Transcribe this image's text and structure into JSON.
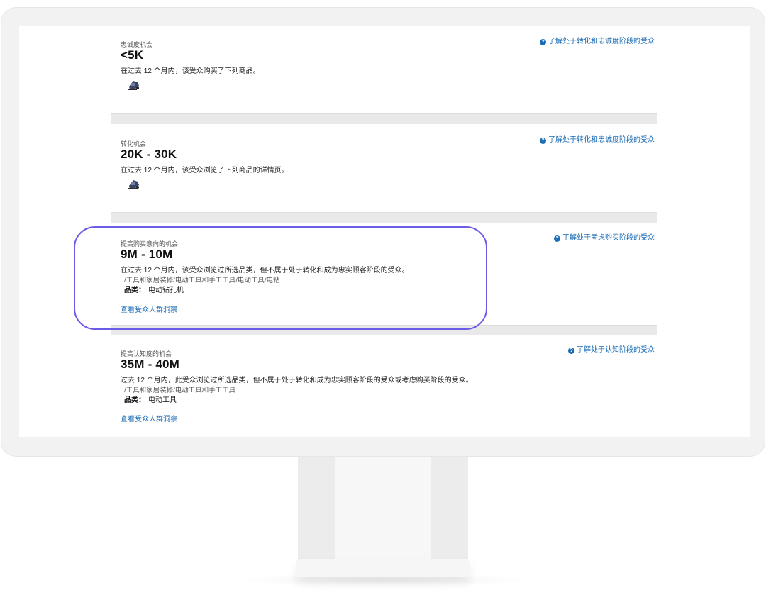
{
  "sections": [
    {
      "kicker": "忠诚度机会",
      "range": "<5K",
      "description": "在过去 12 个月内，该受众购买了下列商品。",
      "help_link": "了解处于转化和忠诚度阶段的受众",
      "thumb_icon": "power-tool-product-icon"
    },
    {
      "kicker": "转化机会",
      "range": "20K - 30K",
      "description": "在过去 12 个月内，该受众浏览了下列商品的详情页。",
      "help_link": "了解处于转化和忠诚度阶段的受众",
      "thumb_icon": "power-tool-product-icon"
    },
    {
      "kicker": "提高购买意向的机会",
      "range": "9M - 10M",
      "description": "在过去 12 个月内，该受众浏览过所选品类，但不属于处于转化和成为忠实顾客阶段的受众。",
      "help_link": "了解处于考虑购买阶段的受众",
      "category_path": "/工具和家居装修/电动工具和手工工具/电动工具/电钻",
      "category_label": "品类：",
      "category_value": "电动钻孔机",
      "insight_link": "查看受众人群洞察"
    },
    {
      "kicker": "提高认知度的机会",
      "range": "35M - 40M",
      "description": "过去 12 个月内，此受众浏览过所选品类，但不属于处于转化和成为忠实顾客阶段的受众或考虑购买阶段的受众。",
      "help_link": "了解处于认知阶段的受众",
      "category_path": "/工具和家居装修/电动工具和手工工具",
      "category_label": "品类：",
      "category_value": "电动工具",
      "insight_link": "查看受众人群洞察"
    }
  ],
  "colors": {
    "link": "#1a6bb5",
    "highlight": "#6a5ce6"
  }
}
